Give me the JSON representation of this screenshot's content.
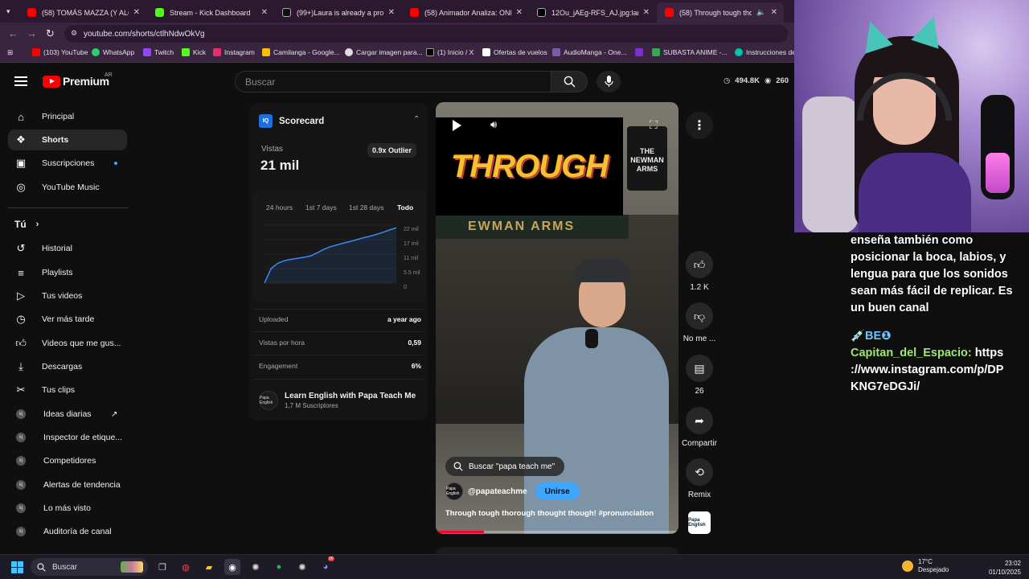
{
  "browser": {
    "tabs": [
      {
        "title": "(58) TOMÁS MAZZA (Y ALONSO",
        "favicon_color": "#ff0000",
        "active": false
      },
      {
        "title": "Stream - Kick Dashboard",
        "favicon_color": "#53fc18",
        "active": false
      },
      {
        "title": "(99+)Laura is already a profess",
        "favicon_color": "#111111",
        "active": false
      },
      {
        "title": "(58) Animador Analiza: ONE PIE",
        "favicon_color": "#ff0000",
        "active": false
      },
      {
        "title": "12Ou_jAEg-RFS_AJ.jpg:large (1:",
        "favicon_color": "#000000",
        "active": false
      },
      {
        "title": "(58) Through tough thorou",
        "favicon_color": "#ff0000",
        "active": true
      }
    ],
    "url": "youtube.com/shorts/ctlhNdwOkVg",
    "bookmarks": [
      {
        "label": "(103) YouTube",
        "color": "#ff0000"
      },
      {
        "label": "WhatsApp",
        "color": "#25d366"
      },
      {
        "label": "Twitch",
        "color": "#9146ff"
      },
      {
        "label": "Kick",
        "color": "#53fc18"
      },
      {
        "label": "Instagram",
        "color": "#e1306c"
      },
      {
        "label": "Camilanga - Google...",
        "color": "#fbbc05"
      },
      {
        "label": "Cargar imagen para...",
        "color": "#dddddd"
      },
      {
        "label": "(1) Inicio / X",
        "color": "#000000"
      },
      {
        "label": "Ofertas de vuelos",
        "color": "#ffffff"
      },
      {
        "label": "AudioManga - One...",
        "color": "#7a5ca8"
      },
      {
        "label": "",
        "color": "#7b2fd0"
      },
      {
        "label": "SUBASTA ANIME -...",
        "color": "#34a853"
      },
      {
        "label": "Instrucciones del",
        "color": "#00c4a7"
      }
    ]
  },
  "youtube": {
    "logo_text": "Premium",
    "country": "AR",
    "search_placeholder": "Buscar",
    "stats": {
      "views": "494.8K",
      "viewers": "260"
    },
    "sidebar": {
      "main": [
        {
          "label": "Principal",
          "icon": "home-icon",
          "active": false
        },
        {
          "label": "Shorts",
          "icon": "shorts-icon",
          "active": true
        },
        {
          "label": "Suscripciones",
          "icon": "subscriptions-icon",
          "active": false,
          "dot": true
        },
        {
          "label": "YouTube Music",
          "icon": "music-icon",
          "active": false
        }
      ],
      "you_header": "Tú",
      "you": [
        {
          "label": "Historial",
          "icon": "history-icon"
        },
        {
          "label": "Playlists",
          "icon": "playlists-icon"
        },
        {
          "label": "Tus videos",
          "icon": "your-videos-icon"
        },
        {
          "label": "Ver más tarde",
          "icon": "watch-later-icon"
        },
        {
          "label": "Videos que me gus...",
          "icon": "like-icon"
        },
        {
          "label": "Descargas",
          "icon": "download-icon"
        },
        {
          "label": "Tus clips",
          "icon": "clips-icon"
        }
      ],
      "vidiq": [
        {
          "label": "Ideas diarias",
          "external": true
        },
        {
          "label": "Inspector de etique...",
          "external": false
        },
        {
          "label": "Competidores",
          "external": false
        },
        {
          "label": "Alertas de tendencia",
          "external": false
        },
        {
          "label": "Lo más visto",
          "external": false
        },
        {
          "label": "Auditoría de canal",
          "external": false
        }
      ]
    },
    "scorecard": {
      "title": "Scorecard",
      "views_label": "Vistas",
      "views_value": "21 mil",
      "outlier": "0.9x Outlier",
      "ranges": [
        "24 hours",
        "1st 7 days",
        "1st 28 days",
        "Todo"
      ],
      "active_range": "Todo",
      "y_ticks": [
        "22 mil",
        "17 mil",
        "11 mil",
        "5.5 mil",
        "0"
      ],
      "rows": [
        {
          "label": "Uploaded",
          "value": "a year ago"
        },
        {
          "label": "Vistas por hora",
          "value": "0,59"
        },
        {
          "label": "Engagement",
          "value": "6%"
        }
      ],
      "channel_name": "Learn English with Papa Teach Me",
      "channel_subs": "1,7 M Suscriptores",
      "channel_avatar_text": "Papa English"
    },
    "short": {
      "title_overlay": "THROUGH",
      "pub_sign": "THE NEWMAN ARMS",
      "storefront_sign": "EWMAN ARMS",
      "search_chip": "Buscar \"papa teach me\"",
      "channel_handle": "@papateachme",
      "join_label": "Unirse",
      "caption": "Through tough thorough thought though! #pronunciation",
      "progress": 0.2
    },
    "actions": [
      {
        "label": "1.2 K",
        "icon": "thumbs-up-icon"
      },
      {
        "label": "No me ...",
        "icon": "thumbs-down-icon"
      },
      {
        "label": "26",
        "icon": "comment-icon"
      },
      {
        "label": "Compartir",
        "icon": "share-icon"
      },
      {
        "label": "Remix",
        "icon": "remix-icon"
      }
    ]
  },
  "chart_data": {
    "type": "line",
    "title": "",
    "xlabel": "",
    "ylabel": "",
    "ylim": [
      0,
      22000
    ],
    "x": [
      0,
      1,
      2,
      3,
      4,
      5,
      6,
      7,
      8,
      9,
      10,
      11,
      12,
      13,
      14,
      15,
      16,
      17,
      18,
      19,
      20
    ],
    "series": [
      {
        "values": [
          0,
          5500,
          7500,
          8500,
          9000,
          9400,
          9800,
          10300,
          11500,
          12800,
          13800,
          14500,
          15200,
          15800,
          16500,
          17200,
          17800,
          18500,
          19300,
          20200,
          21000
        ]
      }
    ]
  },
  "stream_chat": {
    "message1": "enseña también como posicionar la boca, labios, y lengua para que los sonidos sean más fácil de replicar. Es un buen canal",
    "badges": "💉BE❶",
    "user": "Capitan_del_Espacio:",
    "message2": "https ://www.instagram.com/p/DP KNG7eDGJi/"
  },
  "taskbar": {
    "search_label": "Buscar",
    "weather_temp": "17°C",
    "weather_desc": "Despejado",
    "time": "23:02",
    "date": "01/10/2025",
    "discord_badge": "99"
  }
}
